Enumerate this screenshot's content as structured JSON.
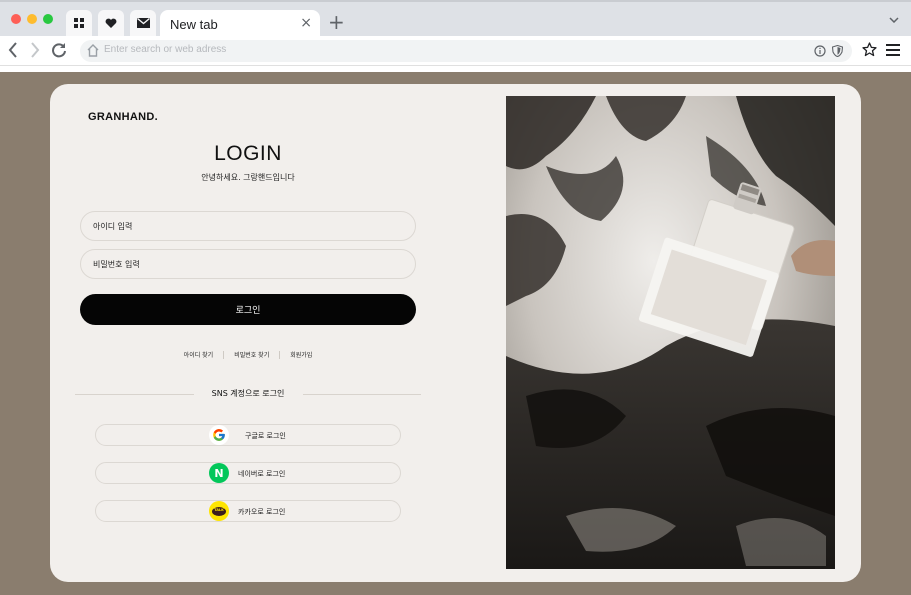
{
  "browser": {
    "tab_title": "New tab",
    "new_tab_symbol": "+",
    "close_symbol": "×",
    "address_placeholder": "Enter search or web adress"
  },
  "page": {
    "brand": "GRANHAND.",
    "title": "LOGIN",
    "subtitle": "안녕하세요. 그랑핸드입니다",
    "id_placeholder": "아이디 입력",
    "password_placeholder": "비밀번호 입력",
    "login_button": "로그인",
    "links": [
      "아이디 찾기",
      "비밀번호 찾기",
      "회원가입"
    ],
    "sns_heading": "SNS 계정으로 로그인",
    "sns_buttons": [
      {
        "label": "구글로 로그인",
        "icon": "google-icon"
      },
      {
        "label": "네이버로 로그인",
        "icon": "naver-icon",
        "icon_text": "N"
      },
      {
        "label": "카카오로 로그인",
        "icon": "kakao-icon",
        "icon_text": "TALK"
      }
    ]
  },
  "colors": {
    "background": "#8a7d6e",
    "card": "#f2efec",
    "button": "#050505",
    "naver": "#03c75a",
    "kakao": "#fee500"
  }
}
